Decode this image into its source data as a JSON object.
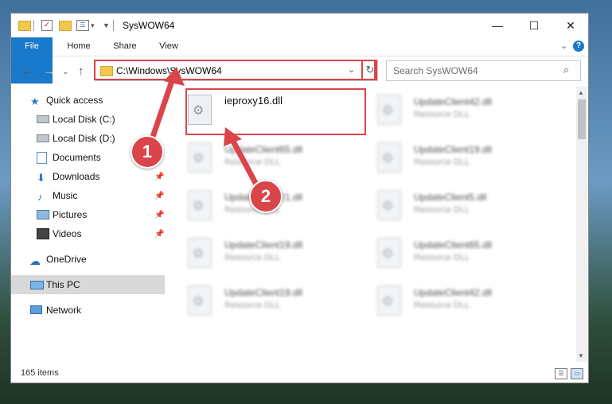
{
  "window": {
    "title": "SysWOW64",
    "minimize": "—",
    "maximize": "☐",
    "close": "✕"
  },
  "ribbon": {
    "tabs": [
      "File",
      "Home",
      "Share",
      "View"
    ],
    "expand_icon": "chevron-down-icon",
    "help": "?"
  },
  "nav": {
    "back": "←",
    "forward": "→",
    "up": "↑",
    "address_path": "C:\\Windows\\SysWOW64",
    "search_placeholder": "Search SysWOW64"
  },
  "sidebar": {
    "items": [
      {
        "label": "Quick access",
        "icon": "star-icon",
        "pinned": false
      },
      {
        "label": "Local Disk (C:)",
        "icon": "drive-icon",
        "pinned": false
      },
      {
        "label": "Local Disk (D:)",
        "icon": "drive-icon",
        "pinned": false
      },
      {
        "label": "Documents",
        "icon": "documents-icon",
        "pinned": true
      },
      {
        "label": "Downloads",
        "icon": "download-icon",
        "pinned": true
      },
      {
        "label": "Music",
        "icon": "music-icon",
        "pinned": true
      },
      {
        "label": "Pictures",
        "icon": "pictures-icon",
        "pinned": true
      },
      {
        "label": "Videos",
        "icon": "videos-icon",
        "pinned": true
      },
      {
        "label": "OneDrive",
        "icon": "cloud-icon",
        "pinned": false
      },
      {
        "label": "This PC",
        "icon": "computer-icon",
        "pinned": false,
        "selected": true
      },
      {
        "label": "Network",
        "icon": "network-icon",
        "pinned": false
      }
    ]
  },
  "files": [
    {
      "name": "ieproxy16.dll",
      "type": "",
      "highlighted": true
    },
    {
      "name": "UpdateClient42.dll",
      "type": "Resource DLL"
    },
    {
      "name": "UpdateClient65.dll",
      "type": "Resource DLL"
    },
    {
      "name": "UpdateClient19.dll",
      "type": "Resource DLL"
    },
    {
      "name": "UpdateClient21.dll",
      "type": "Resource DLL"
    },
    {
      "name": "UpdateClient5.dll",
      "type": "Resource DLL"
    },
    {
      "name": "UpdateClient19.dll",
      "type": "Resource DLL"
    },
    {
      "name": "UpdateClient65.dll",
      "type": "Resource DLL"
    },
    {
      "name": "UpdateClient19.dll",
      "type": "Resource DLL"
    },
    {
      "name": "UpdateClient42.dll",
      "type": "Resource DLL"
    }
  ],
  "status": {
    "item_count": "165 items"
  },
  "callouts": [
    "1",
    "2"
  ],
  "colors": {
    "accent": "#1979ca",
    "highlight": "#d9454a"
  }
}
